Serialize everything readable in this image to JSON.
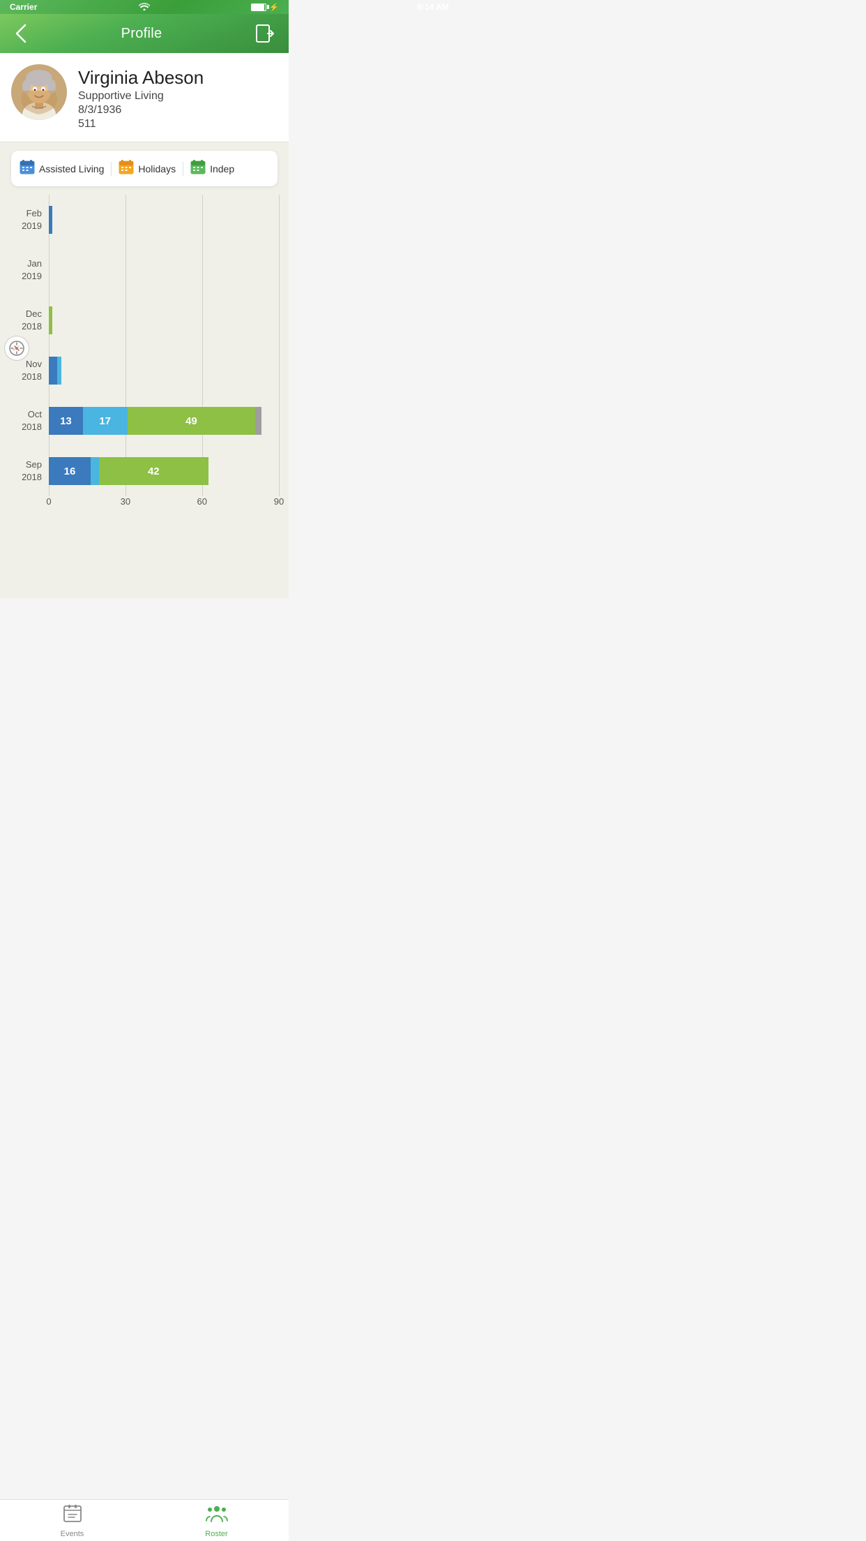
{
  "statusBar": {
    "carrier": "Carrier",
    "time": "9:14 AM",
    "wifi": true,
    "battery": 90
  },
  "navBar": {
    "title": "Profile",
    "backLabel": "‹",
    "logoutLabel": "⎋"
  },
  "profile": {
    "name": "Virginia Abeson",
    "community": "Supportive Living",
    "dob": "8/3/1936",
    "room": "511"
  },
  "filterTabs": [
    {
      "id": "assisted",
      "icon": "blue-cal",
      "label": "Assisted Living"
    },
    {
      "id": "holidays",
      "icon": "yellow-cal",
      "label": "Holidays"
    },
    {
      "id": "indep",
      "icon": "green-cal",
      "label": "Indep"
    }
  ],
  "chart": {
    "xAxis": [
      {
        "value": "0",
        "pos": 0
      },
      {
        "value": "30",
        "pos": 33.3
      },
      {
        "value": "60",
        "pos": 66.6
      },
      {
        "value": "90",
        "pos": 100
      }
    ],
    "rows": [
      {
        "label": "Feb\n2019",
        "segments": [
          {
            "type": "blue-dark",
            "value": 1,
            "label": "",
            "width": 1.5
          }
        ]
      },
      {
        "label": "Jan\n2019",
        "segments": []
      },
      {
        "label": "Dec\n2018",
        "segments": [
          {
            "type": "green",
            "value": 1,
            "label": "",
            "width": 1.5
          }
        ]
      },
      {
        "label": "Nov\n2018",
        "segments": [
          {
            "type": "blue-dark",
            "value": 3,
            "label": "",
            "width": 3.5
          },
          {
            "type": "blue-light",
            "value": 2,
            "label": "",
            "width": 2
          }
        ]
      },
      {
        "label": "Oct\n2018",
        "segments": [
          {
            "type": "blue-dark",
            "value": 13,
            "label": "13",
            "width": 14.8
          },
          {
            "type": "blue-light",
            "value": 17,
            "label": "17",
            "width": 19.3
          },
          {
            "type": "green",
            "value": 49,
            "label": "49",
            "width": 55.7
          },
          {
            "type": "gray",
            "value": 2,
            "label": "",
            "width": 2.5
          }
        ]
      },
      {
        "label": "Sep\n2018",
        "segments": [
          {
            "type": "blue-dark",
            "value": 16,
            "label": "16",
            "width": 18.2
          },
          {
            "type": "blue-light",
            "value": 3,
            "label": "",
            "width": 3.5
          },
          {
            "type": "green",
            "value": 42,
            "label": "42",
            "width": 47.7
          }
        ]
      }
    ]
  },
  "bottomTabs": [
    {
      "id": "events",
      "label": "Events",
      "icon": "📋",
      "active": false
    },
    {
      "id": "roster",
      "label": "Roster",
      "icon": "👥",
      "active": true
    }
  ]
}
